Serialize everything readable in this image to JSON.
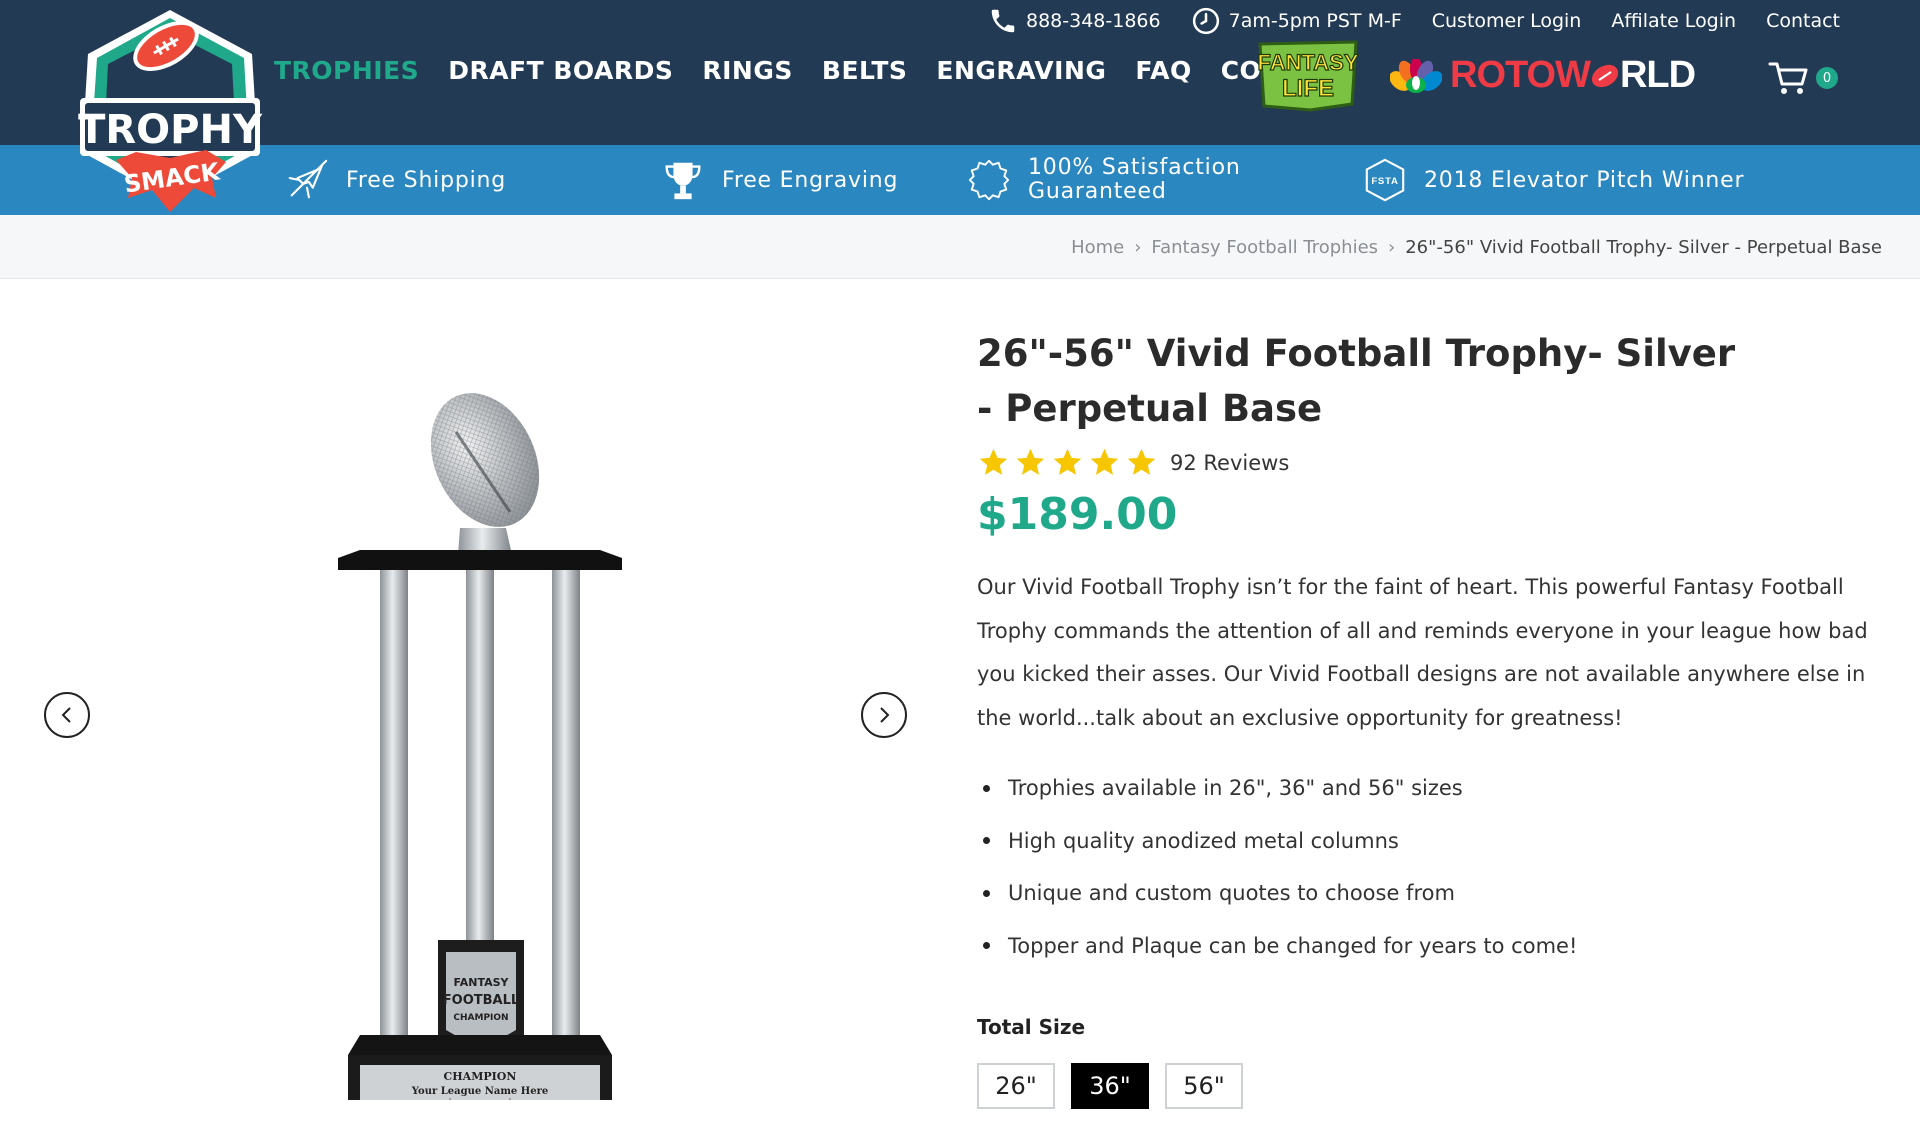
{
  "utility": {
    "phone": "888-348-1866",
    "hours": "7am-5pm PST M-F",
    "customer_login": "Customer Login",
    "affiliate_login": "Affilate Login",
    "contact": "Contact"
  },
  "nav": {
    "items": [
      "TROPHIES",
      "DRAFT BOARDS",
      "RINGS",
      "BELTS",
      "ENGRAVING",
      "FAQ",
      "CONTEST"
    ],
    "active": "TROPHIES"
  },
  "partners": {
    "fantasy_life_line1": "FANTASY",
    "fantasy_life_line2": "LIFE",
    "rotoworld_a": "ROTOW",
    "rotoworld_b": "RLD"
  },
  "cart": {
    "count": "0"
  },
  "logo": {
    "line1": "TROPHY",
    "line2": "SMACK"
  },
  "benefits": {
    "shipping": "Free Shipping",
    "engraving": "Free Engraving",
    "satisfaction_line1": "100% Satisfaction",
    "satisfaction_line2": "Guaranteed",
    "award": "2018 Elevator Pitch Winner",
    "award_badge": "FSTA"
  },
  "breadcrumb": {
    "home": "Home",
    "category": "Fantasy Football Trophies",
    "current": "26\"-56\" Vivid Football Trophy- Silver - Perpetual Base",
    "sep": "›"
  },
  "product": {
    "title": "26\"-56\" Vivid Football Trophy- Silver - Perpetual Base",
    "rating": 5,
    "reviews": "92 Reviews",
    "price": "$189.00",
    "description": "Our Vivid Football Trophy isn’t for the faint of heart. This powerful Fantasy Football Trophy commands the attention of all and reminds everyone in your league how bad you kicked their asses. Our Vivid Football designs are not available anywhere else in the world...talk about an exclusive opportunity for greatness!",
    "features": [
      "Trophies available in 26\", 36\" and 56\" sizes",
      "High quality anodized metal columns",
      "Unique and custom quotes to choose from",
      "Topper and Plaque can be changed for years to come!"
    ],
    "size_label": "Total Size",
    "sizes": [
      "26\"",
      "36\"",
      "56\""
    ],
    "selected_size": "36\""
  },
  "trophy_image": {
    "plaque_line1": "FANTASY",
    "plaque_line2": "FOOTBALL",
    "plaque_line3": "CHAMPION",
    "base_title": "CHAMPION",
    "base_subtitle": "Your League Name Here"
  },
  "colors": {
    "header": "#233a55",
    "benefits_bar": "#2a87c0",
    "accent_green": "#1fa98a",
    "star": "#f6c600",
    "rotoworld_red": "#ee3b45"
  }
}
